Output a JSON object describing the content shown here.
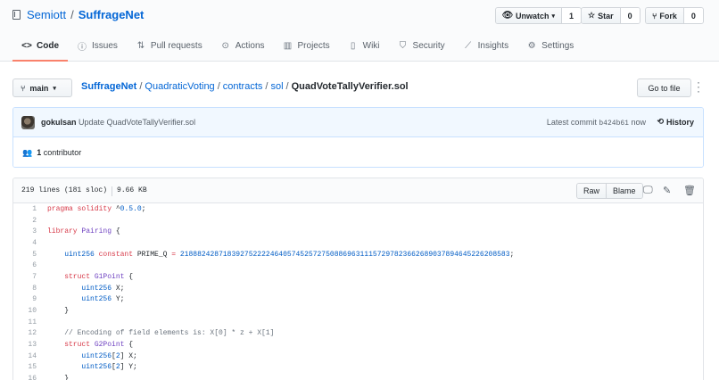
{
  "repo": {
    "owner": "Semiott",
    "separator": "/",
    "name": "SuffrageNet"
  },
  "actions": {
    "watch": {
      "label": "Unwatch",
      "count": "1"
    },
    "star": {
      "label": "Star",
      "count": "0"
    },
    "fork": {
      "label": "Fork",
      "count": "0"
    }
  },
  "tabs": [
    {
      "label": "Code",
      "icon": "code-icon"
    },
    {
      "label": "Issues",
      "icon": "issue-icon"
    },
    {
      "label": "Pull requests",
      "icon": "pull-request-icon"
    },
    {
      "label": "Actions",
      "icon": "play-icon"
    },
    {
      "label": "Projects",
      "icon": "project-icon"
    },
    {
      "label": "Wiki",
      "icon": "book-icon"
    },
    {
      "label": "Security",
      "icon": "shield-icon"
    },
    {
      "label": "Insights",
      "icon": "graph-icon"
    },
    {
      "label": "Settings",
      "icon": "gear-icon"
    }
  ],
  "branch": {
    "label": "main"
  },
  "breadcrumb": {
    "root": "SuffrageNet",
    "parts": [
      "QuadraticVoting",
      "contracts",
      "sol"
    ],
    "file": "QuadVoteTallyVerifier.sol"
  },
  "goto_file": "Go to file",
  "commit": {
    "author": "gokulsan",
    "message": "Update QuadVoteTallyVerifier.sol",
    "latest_label": "Latest commit",
    "sha": "b424b61",
    "when": "now",
    "history": "History"
  },
  "contributors": {
    "count": "1",
    "label": "contributor"
  },
  "file": {
    "lines_info": "219 lines (181 sloc)",
    "size": "9.66 KB",
    "raw": "Raw",
    "blame": "Blame"
  },
  "code_lines": [
    "pragma solidity ^0.5.0;",
    "",
    "library Pairing {",
    "",
    "    uint256 constant PRIME_Q = 21888242871839275222246405745257275088696311157297823662689037894645226208583;",
    "",
    "    struct G1Point {",
    "        uint256 X;",
    "        uint256 Y;",
    "    }",
    "",
    "    // Encoding of field elements is: X[0] * z + X[1]",
    "    struct G2Point {",
    "        uint256[2] X;",
    "        uint256[2] Y;",
    "    }"
  ],
  "colors": {
    "accent": "#0366d6",
    "active_tab_border": "#f9826c",
    "commit_bg": "#f1f8ff"
  }
}
